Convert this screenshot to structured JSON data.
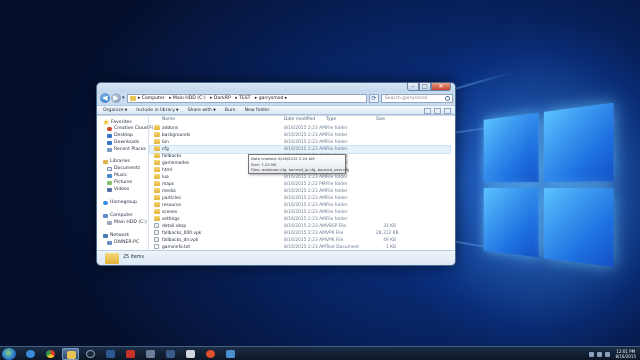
{
  "window": {
    "address": [
      "Computer",
      "Main HDD (C:)",
      "DarkRP",
      "TEST",
      "garrysmod"
    ],
    "search_placeholder": "Search garrysmod",
    "toolbar": [
      "Organize",
      "Include in library",
      "Share with",
      "Burn",
      "New folder"
    ],
    "columns": {
      "name": "Name",
      "date": "Date modified",
      "type": "Type",
      "size": "Size"
    },
    "navpane": {
      "favorites": "Favorites",
      "favorite_items": [
        "Creative Cloud Fi",
        "Desktop",
        "Downloads",
        "Recent Places"
      ],
      "libraries": "Libraries",
      "library_items": [
        "Documents",
        "Music",
        "Pictures",
        "Videos"
      ],
      "homegroup": "Homegroup",
      "computer": "Computer",
      "computer_items": [
        "Main HDD (C:)"
      ],
      "network": "Network",
      "network_items": [
        "DWNER-PC"
      ]
    },
    "files": [
      {
        "name": "addons",
        "date": "8/16/2015 2:23 AM",
        "type": "File folder",
        "size": "",
        "kind": "folder"
      },
      {
        "name": "backgrounds",
        "date": "8/16/2015 2:23 AM",
        "type": "File folder",
        "size": "",
        "kind": "folder"
      },
      {
        "name": "bin",
        "date": "8/16/2015 2:23 AM",
        "type": "File folder",
        "size": "",
        "kind": "folder"
      },
      {
        "name": "cfg",
        "date": "8/16/2015 2:23 AM",
        "type": "File folder",
        "size": "",
        "kind": "folder"
      },
      {
        "name": "fallbacks",
        "date": "8/16/2015 2:23 AM",
        "type": "File folder",
        "size": "",
        "kind": "folder"
      },
      {
        "name": "gamemodes",
        "date": "8/16/2015 2:23 AM",
        "type": "File folder",
        "size": "",
        "kind": "folder"
      },
      {
        "name": "html",
        "date": "8/16/2015 2:23 AM",
        "type": "File folder",
        "size": "",
        "kind": "folder"
      },
      {
        "name": "lua",
        "date": "8/16/2015 2:23 AM",
        "type": "File folder",
        "size": "",
        "kind": "folder"
      },
      {
        "name": "maps",
        "date": "8/16/2015 2:22 PM",
        "type": "File folder",
        "size": "",
        "kind": "folder"
      },
      {
        "name": "media",
        "date": "8/16/2015 2:23 AM",
        "type": "File folder",
        "size": "",
        "kind": "folder"
      },
      {
        "name": "particles",
        "date": "8/16/2015 2:23 AM",
        "type": "File folder",
        "size": "",
        "kind": "folder"
      },
      {
        "name": "resource",
        "date": "8/16/2015 2:23 AM",
        "type": "File folder",
        "size": "",
        "kind": "folder"
      },
      {
        "name": "scenes",
        "date": "8/16/2015 2:23 AM",
        "type": "File folder",
        "size": "",
        "kind": "folder"
      },
      {
        "name": "settings",
        "date": "8/16/2015 2:23 AM",
        "type": "File folder",
        "size": "",
        "kind": "folder"
      },
      {
        "name": "detail.vbsp",
        "date": "8/16/2015 2:23 AM",
        "type": "VBSP File",
        "size": "31 KB",
        "kind": "file"
      },
      {
        "name": "fallbacks_000.vpk",
        "date": "8/16/2015 2:23 AM",
        "type": "VPK File",
        "size": "28,312 KB",
        "kind": "vpk"
      },
      {
        "name": "fallbacks_dir.vpk",
        "date": "8/16/2015 2:23 AM",
        "type": "VPK File",
        "size": "49 KB",
        "kind": "vpk"
      },
      {
        "name": "gameinfo.txt",
        "date": "8/16/2015 2:23 AM",
        "type": "Text Document",
        "size": "1 KB",
        "kind": "txt"
      }
    ],
    "tooltip": [
      "Date created: 8/16/2015 2:24 AM",
      "Size: 7.25 KB",
      "Files: autoexec.cfg, banned_ip.cfg, banned_user.cfg"
    ],
    "status": "25 items"
  },
  "taskbar": {
    "clock_time": "12:01 PM",
    "clock_date": "8/16/2015"
  }
}
